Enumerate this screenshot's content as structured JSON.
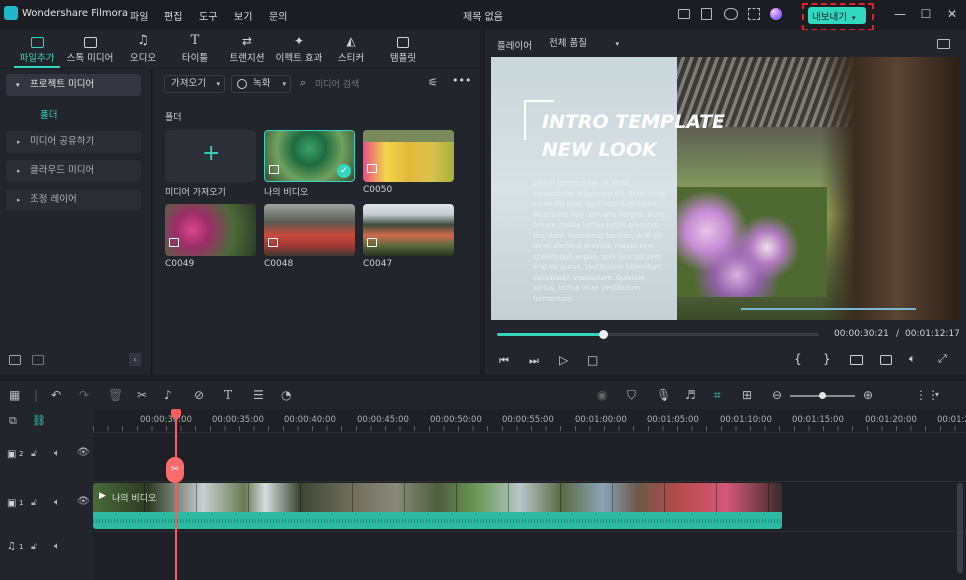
{
  "app": {
    "name": "Wondershare Filmora",
    "doc_title": "제목 없음"
  },
  "menu": [
    "파일",
    "편집",
    "도구",
    "보기",
    "문의"
  ],
  "export_button": "내보내기",
  "toptabs": [
    {
      "label": "파일추가",
      "icon": "media-icon"
    },
    {
      "label": "스톡 미디어",
      "icon": "stock-media-icon"
    },
    {
      "label": "오디오",
      "icon": "music-note-icon"
    },
    {
      "label": "타이틀",
      "icon": "title-t-icon"
    },
    {
      "label": "트랜지션",
      "icon": "transition-icon"
    },
    {
      "label": "이펙트 효과",
      "icon": "effects-icon"
    },
    {
      "label": "스티커",
      "icon": "sticker-icon"
    },
    {
      "label": "템플릿",
      "icon": "template-icon"
    }
  ],
  "sidebar": {
    "project_media": "프로젝트 미디어",
    "folder": "폴더",
    "items": [
      "미디어 공유하기",
      "클라우드 미디어",
      "조정 레이어"
    ]
  },
  "media": {
    "import_dropdown": "가져오기",
    "record_dropdown": "녹화",
    "search_placeholder": "미디어 검색",
    "folder_heading": "폴더",
    "items": [
      {
        "label": "미디어 가져오기"
      },
      {
        "label": "나의 비디오"
      },
      {
        "label": "C0050"
      },
      {
        "label": "C0049"
      },
      {
        "label": "C0048"
      },
      {
        "label": "C0047"
      }
    ]
  },
  "player": {
    "label": "플레이어",
    "quality": "전체 품질",
    "overlay_title_1": "INTRO TEMPLATE",
    "overlay_title_2": "NEW LOOK",
    "overlay_body": "Lorem ipsum dolor sit amet, consectetur adipiscing elit. Maecenas eu mollis erat, eget interdum tortor. Maecenas non convallis magna. Nunc ornare massa luctus turpis placerat, tincidunt. Maecenas facilisis, velit sit amet eleifend gravida, massa sem scelerisque augue, quis suscipit sem erat eu purus. Vestibulum bibendum sollicitudin vestibulum. Quisque luctus, lectus vitae vestibulum fermentum.",
    "current_time": "00:00:30:21",
    "separator": "/",
    "total_time": "00:01:12:17",
    "progress": 0.33
  },
  "timeline": {
    "ruler": [
      "00:00:30:00",
      "00:00:35:00",
      "00:00:40:00",
      "00:00:45:00",
      "00:00:50:00",
      "00:00:55:00",
      "00:01:00:00",
      "00:01:05:00",
      "00:01:10:00",
      "00:01:15:00",
      "00:01:20:00",
      "00:01:2"
    ],
    "clip_label": "나의 비디오",
    "tracks": [
      {
        "num": "2",
        "type": "video"
      },
      {
        "num": "1",
        "type": "video"
      },
      {
        "num": "1",
        "type": "audio"
      }
    ]
  }
}
